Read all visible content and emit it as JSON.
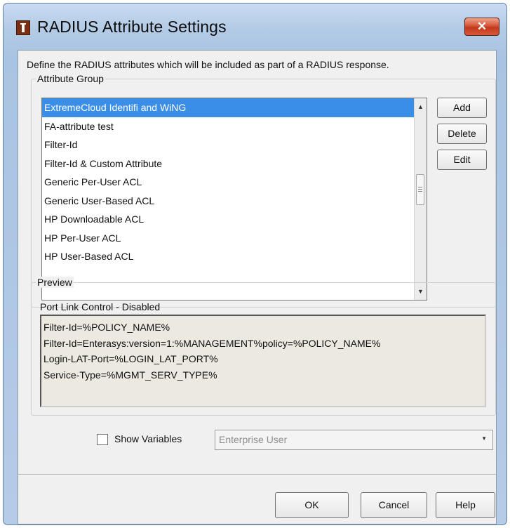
{
  "window": {
    "title": "RADIUS Attribute Settings",
    "close_glyph": "✕",
    "icon": "app-icon"
  },
  "description": "Define the RADIUS attributes which will be included as part of a RADIUS response.",
  "attribute_group": {
    "legend": "Attribute Group",
    "items": [
      "ExtremeCloud Identifi and WiNG",
      "FA-attribute test",
      "Filter-Id",
      "Filter-Id & Custom Attribute",
      "Generic Per-User ACL",
      "Generic User-Based ACL",
      "HP Downloadable ACL",
      "HP Per-User ACL",
      "HP User-Based ACL"
    ],
    "selected_index": 0,
    "buttons": {
      "add": "Add",
      "delete": "Delete",
      "edit": "Edit"
    }
  },
  "preview": {
    "legend": "Preview",
    "label": "Port Link Control - Disabled",
    "lines": [
      "Filter-Id=%POLICY_NAME%",
      "Filter-Id=Enterasys:version=1:%MANAGEMENT%policy=%POLICY_NAME%",
      "Login-LAT-Port=%LOGIN_LAT_PORT%",
      "Service-Type=%MGMT_SERV_TYPE%"
    ]
  },
  "show_variables": {
    "label": "Show Variables",
    "checked": false,
    "select_value": "Enterprise User"
  },
  "footer": {
    "ok": "OK",
    "cancel": "Cancel",
    "help": "Help"
  },
  "colors": {
    "selection": "#3a8ee6",
    "close_button": "#c7452a",
    "title_bar": "#b3cbe6"
  }
}
